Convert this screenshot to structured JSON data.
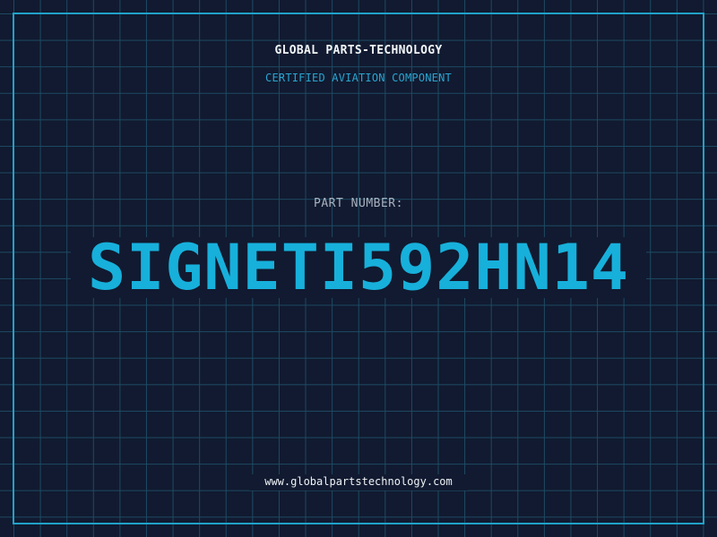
{
  "header": {
    "company": "GLOBAL PARTS-TECHNOLOGY",
    "subtitle": "CERTIFIED AVIATION COMPONENT"
  },
  "part": {
    "label": "PART NUMBER:",
    "number": "SIGNETI592HN14"
  },
  "footer": {
    "website": "www.globalpartstechnology.com"
  },
  "colors": {
    "background": "#111a30",
    "grid": "#1d4a63",
    "accent": "#17b0db",
    "frame": "#1fa2c9"
  }
}
